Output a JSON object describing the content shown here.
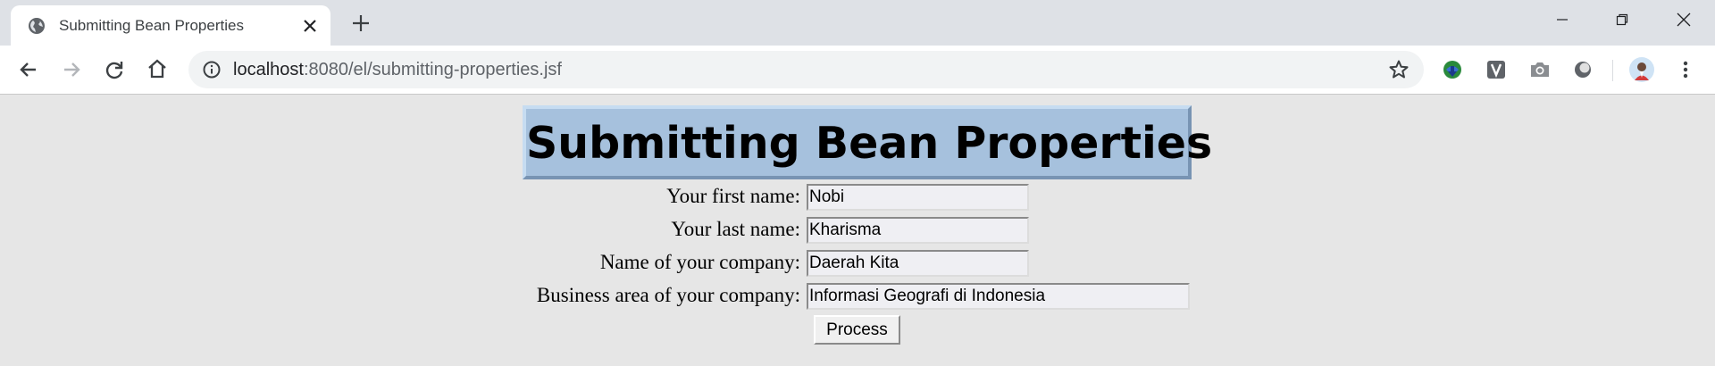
{
  "browser": {
    "tab_title": "Submitting Bean Properties",
    "tab_favicon": "globe-icon",
    "url_host": "localhost",
    "url_rest": ":8080/el/submitting-properties.jsf",
    "icons": {
      "back": "back-arrow-icon",
      "forward": "forward-arrow-icon",
      "reload": "reload-icon",
      "home": "home-icon",
      "info": "info-icon",
      "bookmark": "star-icon",
      "extensions": [
        "idm-icon",
        "v-extension-icon",
        "camera-icon",
        "circle-extension-icon"
      ],
      "profile": "avatar",
      "menu": "kebab-menu-icon",
      "minimize": "minimize-icon",
      "restore": "restore-icon",
      "close": "close-icon"
    }
  },
  "page": {
    "heading": "Submitting Bean Properties",
    "form": {
      "first_name_label": "Your first name:",
      "first_name_value": "Nobi",
      "last_name_label": "Your last name:",
      "last_name_value": "Kharisma",
      "company_label": "Name of your company:",
      "company_value": "Daerah Kita",
      "business_label": "Business area of your company:",
      "business_value": "Informasi Geografi di Indonesia",
      "submit_label": "Process"
    }
  }
}
